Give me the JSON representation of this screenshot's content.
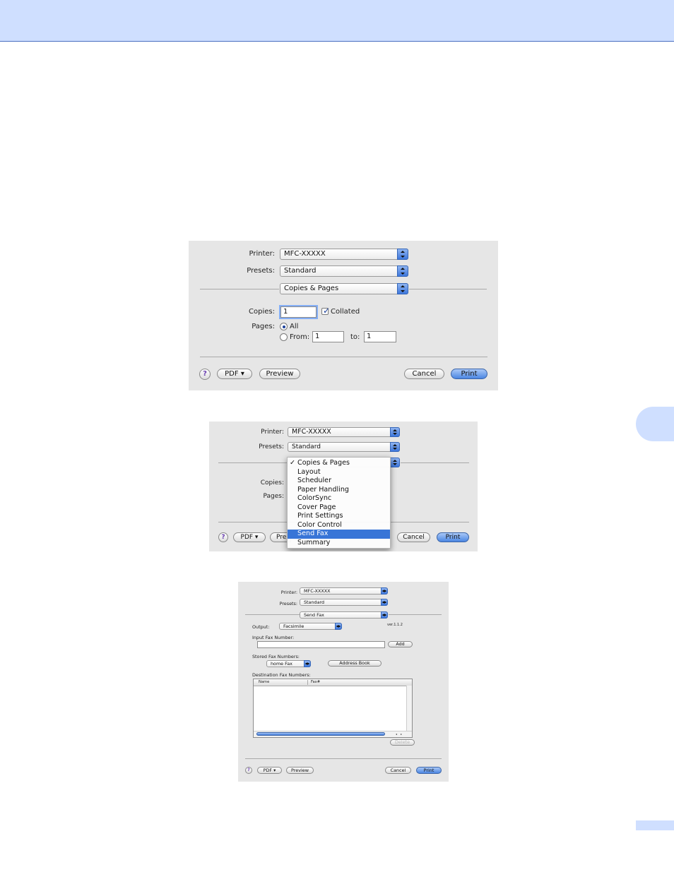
{
  "dialog1": {
    "printer_label": "Printer:",
    "printer_value": "MFC-XXXXX",
    "presets_label": "Presets:",
    "presets_value": "Standard",
    "panel_value": "Copies & Pages",
    "copies_label": "Copies:",
    "copies_value": "1",
    "collated_label": "Collated",
    "collated_checked": true,
    "pages_label": "Pages:",
    "all_label": "All",
    "from_label": "From:",
    "from_value": "1",
    "to_label": "to:",
    "to_value": "1",
    "help": "?",
    "pdf_button": "PDF ▾",
    "preview_button": "Preview",
    "cancel_button": "Cancel",
    "print_button": "Print"
  },
  "dialog2": {
    "printer_label": "Printer:",
    "printer_value": "MFC-XXXXX",
    "presets_label": "Presets:",
    "presets_value": "Standard",
    "copies_label": "Copies:",
    "pages_label": "Pages:",
    "menu_check": "✓",
    "menu_items": [
      "Copies & Pages",
      "Layout",
      "Scheduler",
      "Paper Handling",
      "ColorSync",
      "Cover Page",
      "Print Settings",
      "Color Control",
      "Send Fax",
      "Summary"
    ],
    "selected_item": "Send Fax",
    "help": "?",
    "pdf_button": "PDF ▾",
    "preview_button_partial": "Pre",
    "cancel_button": "Cancel",
    "print_button": "Print"
  },
  "dialog3": {
    "printer_label": "Printer:",
    "printer_value": "MFC-XXXXX",
    "presets_label": "Presets:",
    "presets_value": "Standard",
    "panel_value": "Send Fax",
    "output_label": "Output:",
    "output_value": "Facsimile",
    "version": "ver.1.1.2",
    "input_fax_label": "Input Fax Number:",
    "input_fax_value": "",
    "add_button": "Add",
    "stored_label": "Stored Fax Numbers:",
    "stored_value": "home Fax",
    "address_book_button": "Address Book",
    "destination_label": "Destination Fax Numbers:",
    "col_name": "Name",
    "col_fax": "Fax#",
    "delete_button": "Delete",
    "help": "?",
    "pdf_button": "PDF ▾",
    "preview_button": "Preview",
    "cancel_button": "Cancel",
    "print_button": "Print"
  },
  "colors": {
    "accent_blue": "#3875d7",
    "header_band": "#cfdfff"
  }
}
